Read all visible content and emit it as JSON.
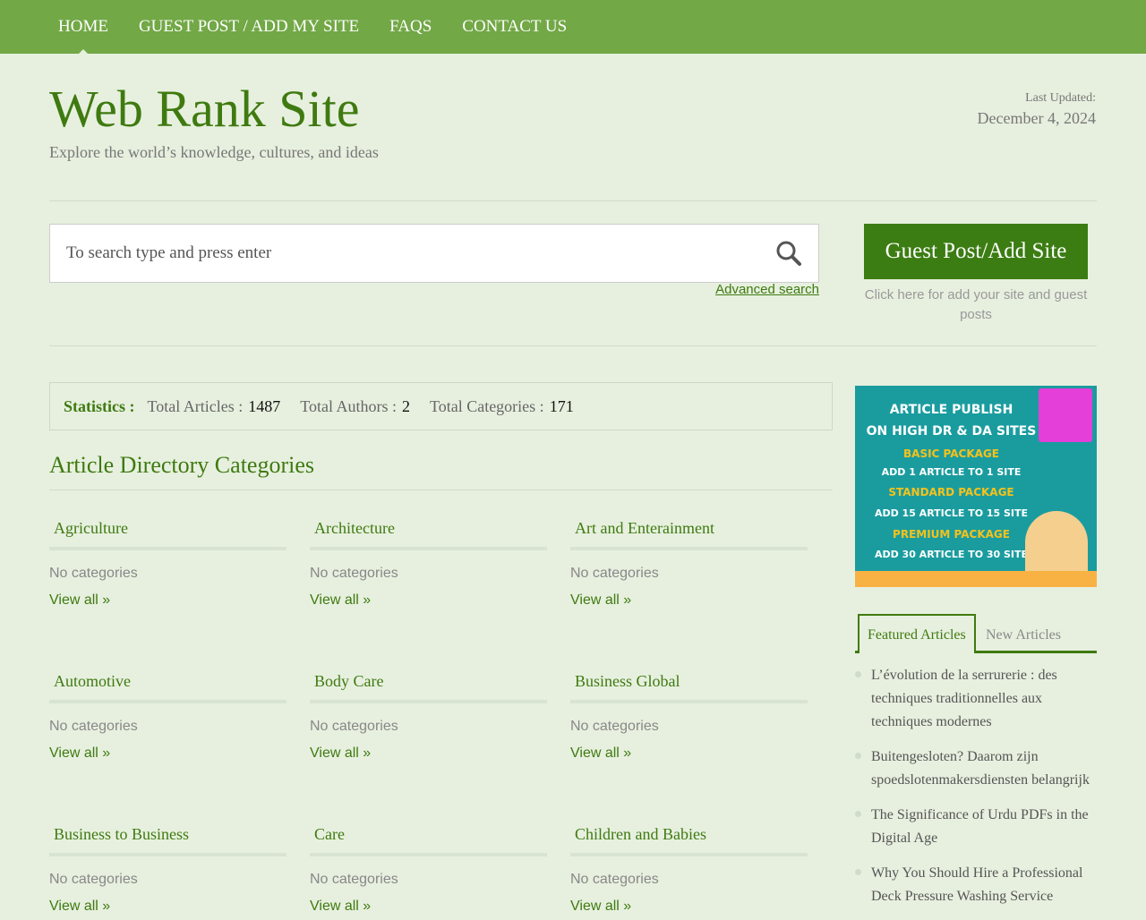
{
  "nav": [
    "HOME",
    "GUEST POST / ADD MY SITE",
    "FAQS",
    "CONTACT US"
  ],
  "header": {
    "title": "Web Rank Site",
    "tagline": "Explore the world’s knowledge, cultures, and ideas",
    "updated_label": "Last Updated:",
    "updated_value": "December 4, 2024"
  },
  "search": {
    "placeholder": "To search type and press enter",
    "advanced": "Advanced search"
  },
  "guest": {
    "button": "Guest Post/Add Site",
    "sub": "Click here for add your site and guest posts"
  },
  "stats": {
    "label": "Statistics :",
    "articles_label": "Total Articles :",
    "articles": "1487",
    "authors_label": "Total Authors :",
    "authors": "2",
    "categories_label": "Total Categories :",
    "categories": "171"
  },
  "section_title": "Article Directory Categories",
  "categories": [
    {
      "name": "Agriculture",
      "sub": "No categories",
      "link": "View all »"
    },
    {
      "name": "Architecture",
      "sub": "No categories",
      "link": "View all »"
    },
    {
      "name": "Art and Enterainment",
      "sub": "No categories",
      "link": "View all »"
    },
    {
      "name": "Automotive",
      "sub": "No categories",
      "link": "View all »"
    },
    {
      "name": "Body Care",
      "sub": "No categories",
      "link": "View all »"
    },
    {
      "name": "Business Global",
      "sub": "No categories",
      "link": "View all »"
    },
    {
      "name": "Business to Business",
      "sub": "No categories",
      "link": "View all »"
    },
    {
      "name": "Care",
      "sub": "No categories",
      "link": "View all »"
    },
    {
      "name": "Children and Babies",
      "sub": "No categories",
      "link": "View all »"
    }
  ],
  "ad": [
    "ARTICLE PUBLISH",
    "ON HIGH DR & DA SITES",
    "BASIC PACKAGE",
    "ADD 1 ARTICLE TO 1 SITE",
    "STANDARD PACKAGE",
    "ADD 15 ARTICLE TO 15 SITE",
    "PREMIUM PACKAGE",
    "ADD 30 ARTICLE TO 30 SITE"
  ],
  "tabs": {
    "featured": "Featured Articles",
    "new": "New Articles"
  },
  "featured": [
    "L’évolution de la serrurerie : des techniques traditionnelles aux techniques modernes",
    "Buitengesloten? Daarom zijn spoedslotenmakersdiensten belangrijk",
    "The Significance of Urdu PDFs in the Digital Age",
    "Why You Should Hire a Professional Deck Pressure Washing Service"
  ]
}
